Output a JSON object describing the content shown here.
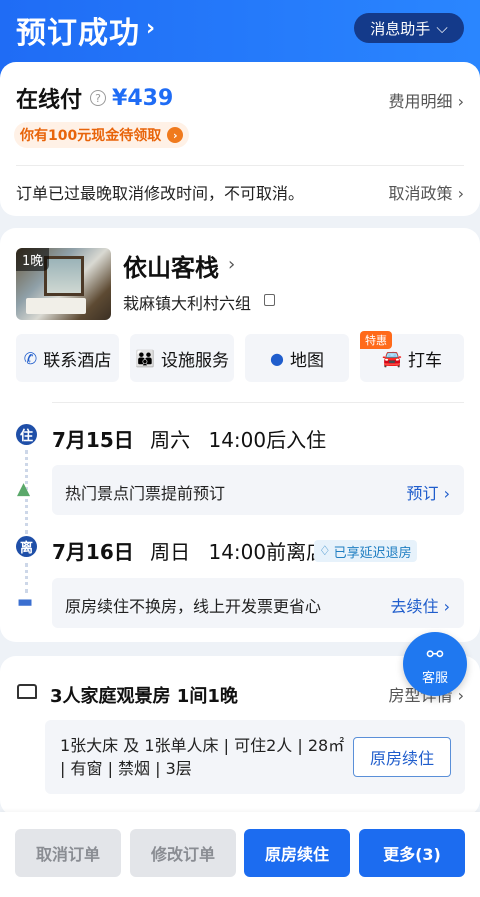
{
  "header": {
    "title": "预订成功",
    "title_chevron": "›",
    "assistant_label": "消息助手",
    "assistant_chevron": "⌵"
  },
  "payment": {
    "title": "在线付",
    "help_symbol": "?",
    "price": "¥439",
    "fee_detail": "费用明细 ›",
    "cash_badge": "你有100元现金待领取",
    "cash_go": "›",
    "cancel_note": "订单已过最晚取消修改时间，不可取消。",
    "cancel_policy": "取消政策 ›"
  },
  "hotel": {
    "nights_badge": "1晚",
    "name": "依山客栈",
    "name_chevron": "›",
    "address": "栽麻镇大利村六组",
    "actions": [
      {
        "label": "联系酒店",
        "icon": "phone-icon"
      },
      {
        "label": "设施服务",
        "icon": "people-icon"
      },
      {
        "label": "地图",
        "icon": "location-pin-icon"
      },
      {
        "label": "打车",
        "icon": "car-icon",
        "tag": "特惠"
      }
    ]
  },
  "stay": {
    "checkin": {
      "badge": "住",
      "date": "7月15日",
      "weekday": "周六",
      "time": "14:00后入住"
    },
    "ticket": {
      "text": "热门景点门票提前预订",
      "link": "预订 ›",
      "icon": "mountain-icon"
    },
    "checkout": {
      "badge": "离",
      "date": "7月16日",
      "weekday": "周日",
      "time": "14:00前离店",
      "late_badge": "已享延迟退房"
    },
    "renew": {
      "text": "原房续住不换房，线上开发票更省心",
      "link": "去续住 ›",
      "icon": "bed-icon"
    }
  },
  "room": {
    "title": "3人家庭观景房  1间1晚",
    "type_link": "房型详情 ›",
    "detail": "1张大床 及 1张单人床 | 可住2人 | 28㎡ | 有窗 | 禁烟 | 3层",
    "renew_button": "原房续住"
  },
  "customer_service": {
    "label": "客服",
    "icon": "chat-icon"
  },
  "bottom": {
    "cancel_order": "取消订单",
    "modify_order": "修改订单",
    "renew": "原房续住",
    "more": "更多(3)"
  },
  "colors": {
    "primary": "#1c6cf0",
    "header_gradient_start": "#1f6cf5",
    "accent_orange": "#ff6a1a",
    "navy_badge": "#143a8a"
  }
}
